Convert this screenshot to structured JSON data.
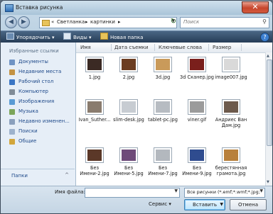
{
  "window": {
    "title": "Вставка рисунка",
    "close_glyph": "✕"
  },
  "address": {
    "back_glyph": "◀",
    "forward_glyph": "▶",
    "prefix": "«",
    "crumbs": [
      "Светланка",
      "картинки"
    ],
    "separator": "▸",
    "refresh_glyph": "↻",
    "search_placeholder": "Поиск"
  },
  "toolbar": {
    "organize": "Упорядочить",
    "views": "Виды",
    "new_folder": "Новая папка",
    "help": "?"
  },
  "sidebar": {
    "header": "Избранные ссылки",
    "items": [
      {
        "label": "Документы",
        "color": "#6f93c4"
      },
      {
        "label": "Недавние места",
        "color": "#c39243"
      },
      {
        "label": "Рабочий стол",
        "color": "#3a75c4"
      },
      {
        "label": "Компьютер",
        "color": "#7f8b97"
      },
      {
        "label": "Изображения",
        "color": "#5a9bd4"
      },
      {
        "label": "Музыка",
        "color": "#7ba55a"
      },
      {
        "label": "Недавно изменен...",
        "color": "#8aa0bd"
      },
      {
        "label": "Поиски",
        "color": "#9db2cc"
      },
      {
        "label": "Общие",
        "color": "#d2a63c"
      }
    ],
    "folders_label": "Папки",
    "folders_chevron": "^"
  },
  "columns": [
    "Имя",
    "Дата съемки",
    "Ключевые слова",
    "Размер"
  ],
  "files": [
    {
      "name": "1.jpg",
      "color": "#3b2a24"
    },
    {
      "name": "2.jpg",
      "color": "#6b3d22"
    },
    {
      "name": "3d.jpg",
      "color": "#c99a5a"
    },
    {
      "name": "3d Сканер.jpg",
      "color": "#7a1f1c"
    },
    {
      "name": "image007.jpg",
      "color": "#d9d9d9"
    },
    {
      "name": "Ivan_Suther...",
      "color": "#8a7c6e"
    },
    {
      "name": "slim-desk.jpg",
      "color": "#c7ccd2"
    },
    {
      "name": "tablet-pc.jpg",
      "color": "#b7bcc2"
    },
    {
      "name": "viner.gif",
      "color": "#9b9b9b"
    },
    {
      "name": "Андриес Ван Дам.jpg",
      "color": "#6d5a4c"
    },
    {
      "name": "Без Имени-2.jpg",
      "color": "#5b3828"
    },
    {
      "name": "Без Имени-5.jpg",
      "color": "#6e4a79"
    },
    {
      "name": "Без Имени-7.jpg",
      "color": "#b3b8be"
    },
    {
      "name": "Без Имени-9.jpg",
      "color": "#2f4c8f"
    },
    {
      "name": "берестянная грамота.jpg",
      "color": "#b8803c"
    }
  ],
  "bottom": {
    "filename_label": "Имя файла:",
    "filename_value": "",
    "filetype_value": "Все рисунки (*.emf;*.wmf;*.jpg;",
    "service_label": "Сервис",
    "insert_label": "Вставить",
    "cancel_label": "Отмена",
    "dropdown_glyph": "▼"
  }
}
